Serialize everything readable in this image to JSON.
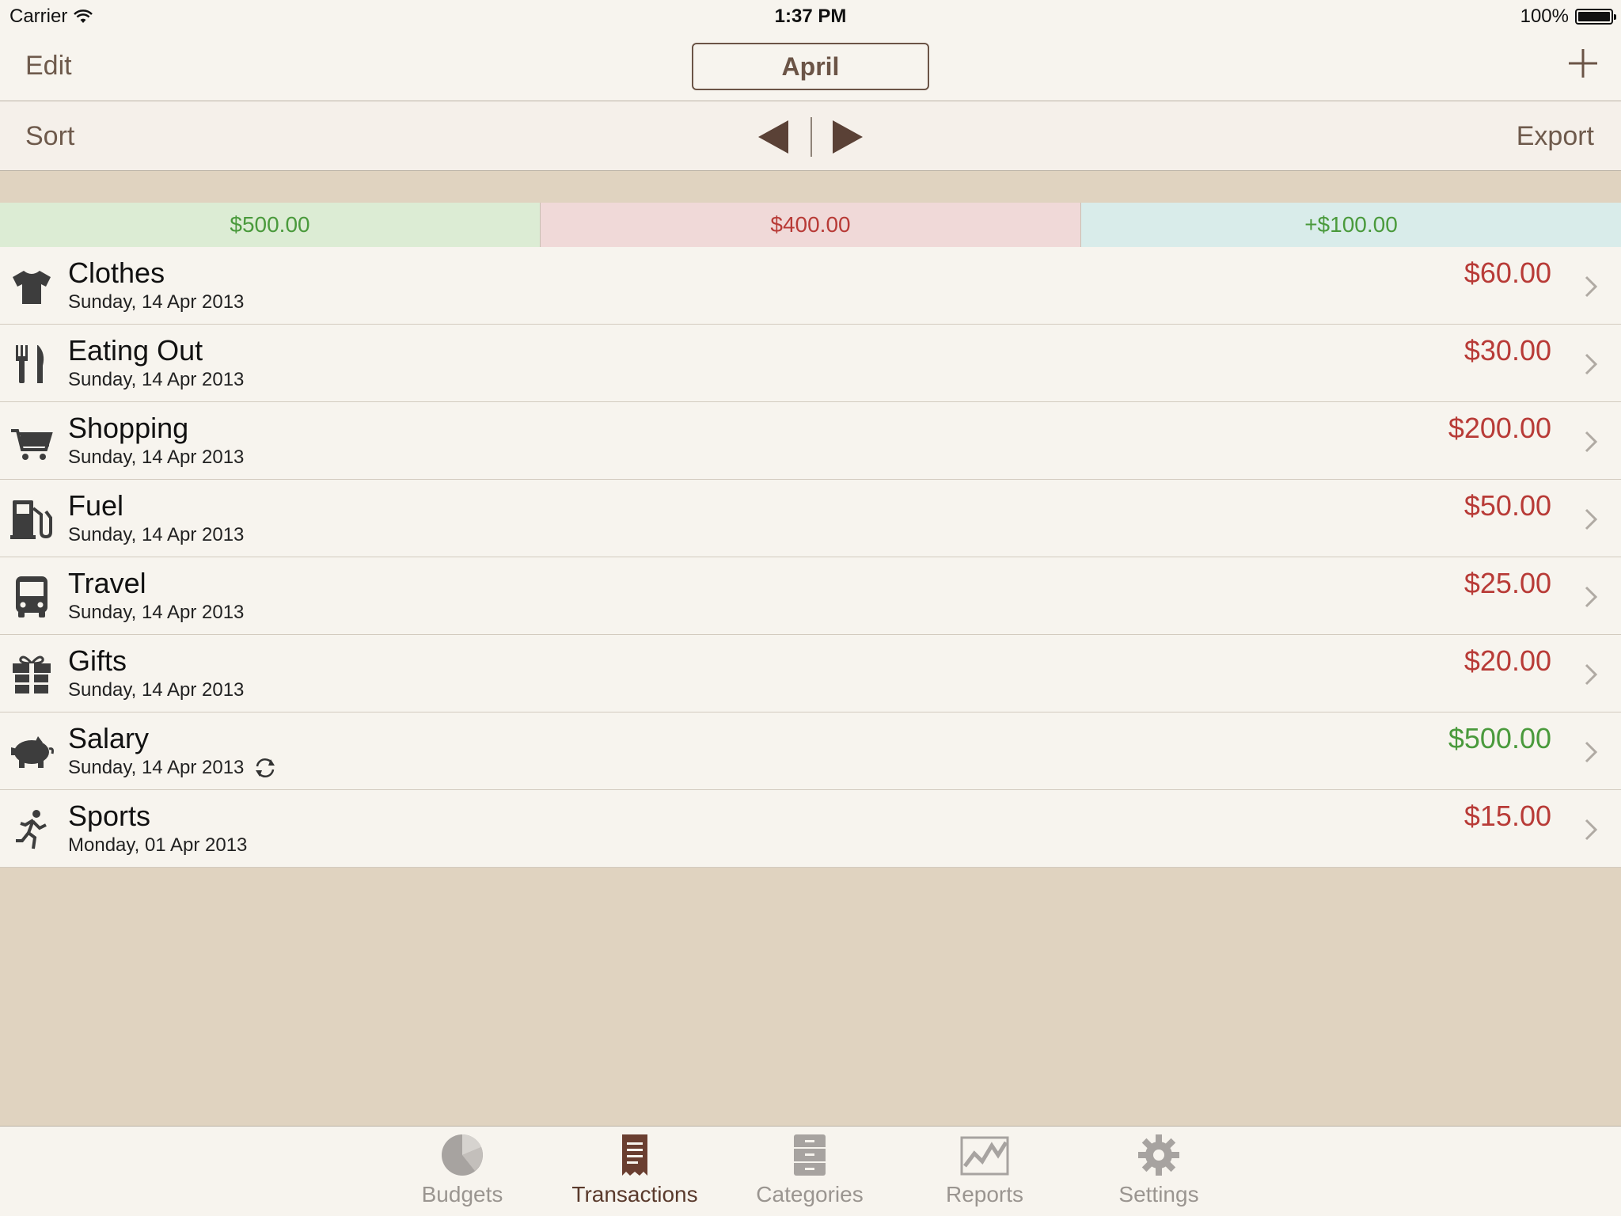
{
  "status_bar": {
    "carrier": "Carrier",
    "time": "1:37 PM",
    "battery": "100%"
  },
  "nav": {
    "edit_label": "Edit",
    "title": "April",
    "add_icon": "plus-icon"
  },
  "toolbar": {
    "sort_label": "Sort",
    "export_label": "Export",
    "prev_icon": "triangle-left-icon",
    "next_icon": "triangle-right-icon"
  },
  "summary": {
    "income": "$500.00",
    "expense": "$400.00",
    "balance": "+$100.00"
  },
  "transactions": [
    {
      "name": "Clothes",
      "date": "Sunday, 14 Apr 2013",
      "amount": "$60.00",
      "type": "expense",
      "icon": "tshirt-icon"
    },
    {
      "name": "Eating Out",
      "date": "Sunday, 14 Apr 2013",
      "amount": "$30.00",
      "type": "expense",
      "icon": "fork-knife-icon"
    },
    {
      "name": "Shopping",
      "date": "Sunday, 14 Apr 2013",
      "amount": "$200.00",
      "type": "expense",
      "icon": "cart-icon"
    },
    {
      "name": "Fuel",
      "date": "Sunday, 14 Apr 2013",
      "amount": "$50.00",
      "type": "expense",
      "icon": "fuel-pump-icon"
    },
    {
      "name": "Travel",
      "date": "Sunday, 14 Apr 2013",
      "amount": "$25.00",
      "type": "expense",
      "icon": "bus-icon"
    },
    {
      "name": "Gifts",
      "date": "Sunday, 14 Apr 2013",
      "amount": "$20.00",
      "type": "expense",
      "icon": "gift-icon"
    },
    {
      "name": "Salary",
      "date": "Sunday, 14 Apr 2013",
      "amount": "$500.00",
      "type": "income",
      "icon": "piggy-bank-icon",
      "recurring": true
    },
    {
      "name": "Sports",
      "date": "Monday, 01 Apr 2013",
      "amount": "$15.00",
      "type": "expense",
      "icon": "runner-icon"
    }
  ],
  "tabs": [
    {
      "label": "Budgets",
      "icon": "pie-chart-icon",
      "active": false
    },
    {
      "label": "Transactions",
      "icon": "receipt-icon",
      "active": true
    },
    {
      "label": "Categories",
      "icon": "cabinet-icon",
      "active": false
    },
    {
      "label": "Reports",
      "icon": "line-chart-icon",
      "active": false
    },
    {
      "label": "Settings",
      "icon": "gear-icon",
      "active": false
    }
  ],
  "colors": {
    "accent": "#6b5446",
    "expense": "#b83b37",
    "income": "#4a9a3c",
    "background": "#e0d3c0"
  }
}
